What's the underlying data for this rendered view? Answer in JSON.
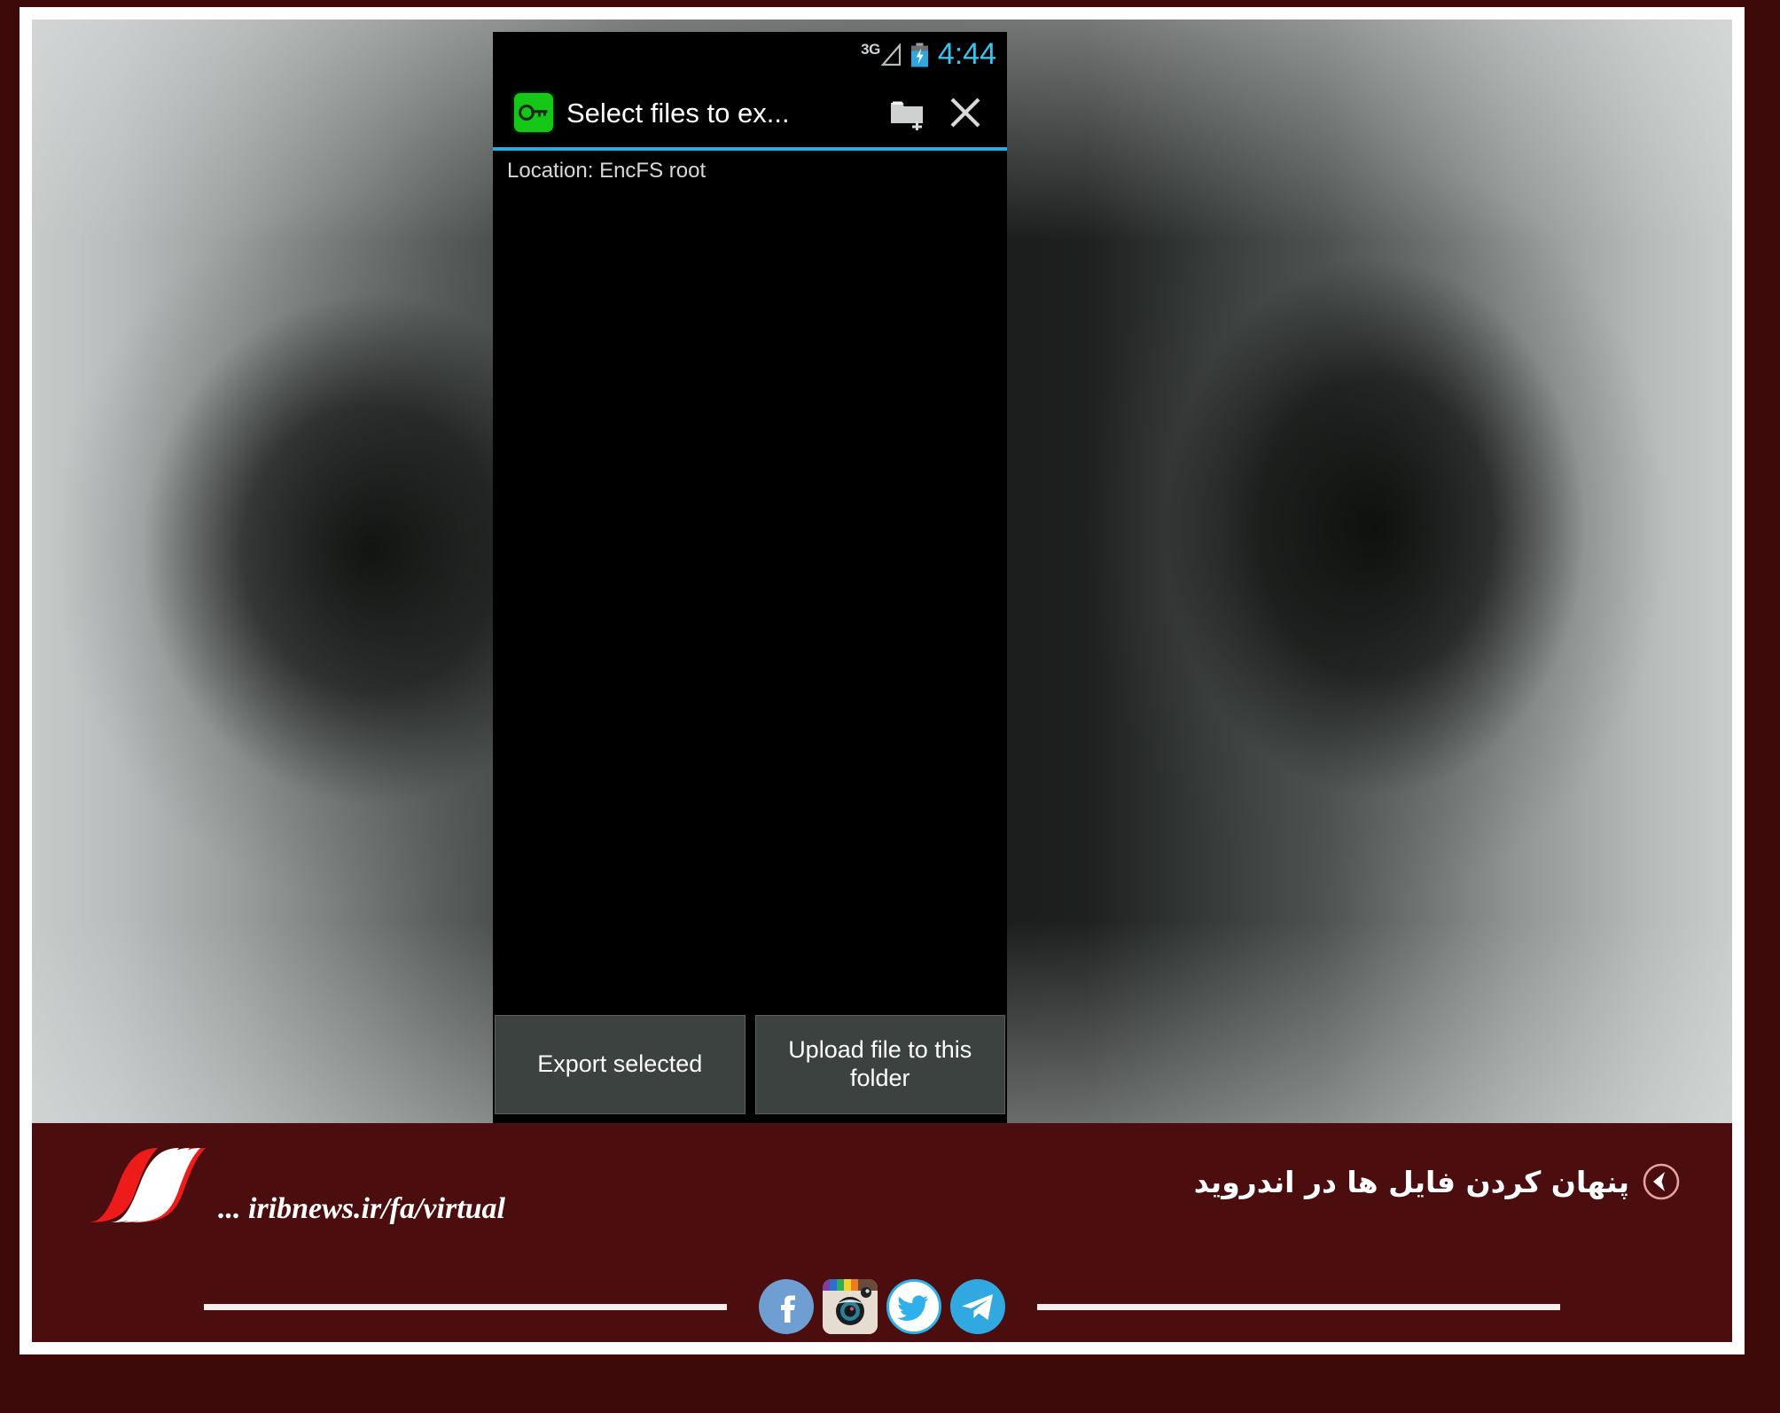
{
  "page": {
    "outer_bg": "#3d0909",
    "frame_color": "#ffffff",
    "footer_bg": "#4b0d0d"
  },
  "phone": {
    "statusbar": {
      "network_label": "3G",
      "signal_icon": "signal-empty-icon",
      "battery_icon": "battery-charging-icon",
      "time": "4:44",
      "time_color": "#36c3f2"
    },
    "actionbar": {
      "app_icon": "key-icon",
      "app_icon_color": "#15c716",
      "title": "Select files to ex...",
      "new_folder_icon": "new-folder-icon",
      "close_icon": "close-icon",
      "divider_color": "#2ba8e0"
    },
    "location_label": "Location: EncFS root",
    "file_list": {
      "items": [],
      "empty": true
    },
    "buttons": {
      "export_label": "Export selected",
      "upload_label": "Upload file to this folder"
    }
  },
  "footer": {
    "brand_url": "... iribnews.ir/fa/virtual",
    "brand_logo": "irib-wave-logo",
    "headline": "پنهان کردن فایل ها در اندروید",
    "headline_arrow_icon": "back-arrow-circle-icon",
    "social": [
      {
        "name": "facebook-icon",
        "label": "f"
      },
      {
        "name": "instagram-icon",
        "label": ""
      },
      {
        "name": "twitter-icon",
        "label": ""
      },
      {
        "name": "telegram-icon",
        "label": ""
      }
    ]
  }
}
